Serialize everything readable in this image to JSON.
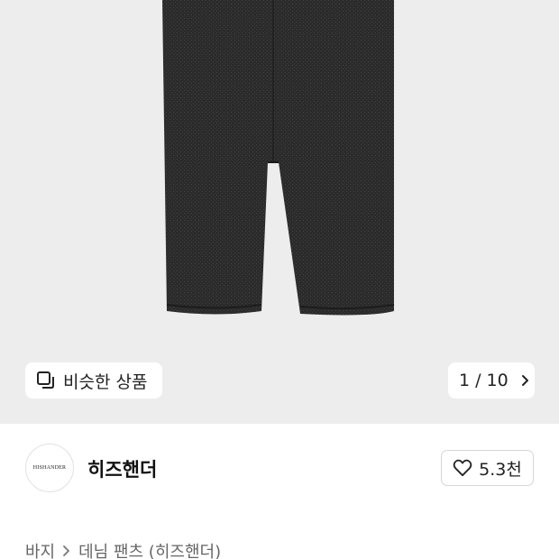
{
  "product_image": {
    "similar_button_label": "비슷한 상품",
    "similar_icon": "similar-items-icon",
    "pager_current": "1",
    "pager_separator": "/",
    "pager_total": "10",
    "pager_icon": "chevron-right-icon"
  },
  "brand": {
    "logo_text": "HISHANDER",
    "name": "히즈핸더",
    "like_icon": "heart-icon",
    "like_count": "5.3천"
  },
  "breadcrumb": {
    "items": [
      "바지",
      "데님 팬츠 (히즈핸더)"
    ],
    "separator_icon": "chevron-right-icon"
  },
  "colors": {
    "hero_background": "#ededed",
    "denim": "#2b2b2b"
  }
}
